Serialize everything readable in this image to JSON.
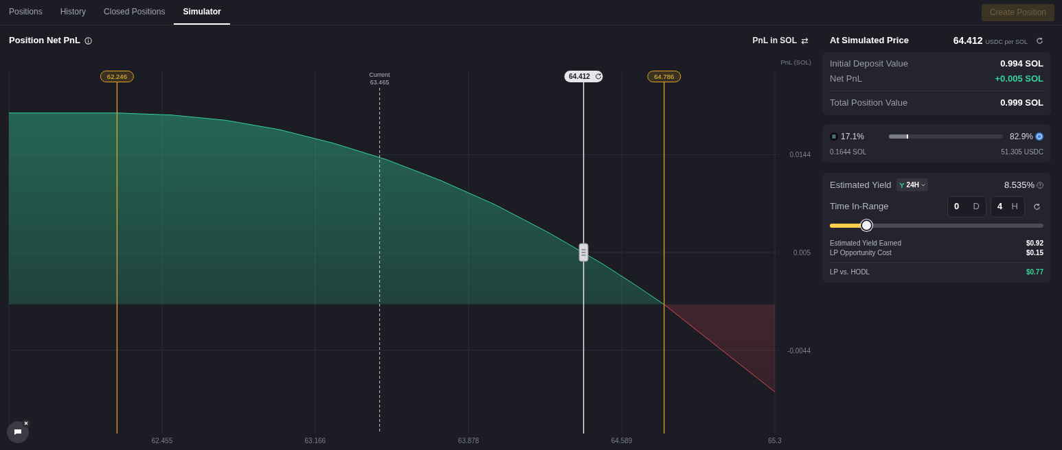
{
  "tabs": [
    {
      "label": "Positions",
      "selected": false
    },
    {
      "label": "History",
      "selected": false
    },
    {
      "label": "Closed Positions",
      "selected": false
    },
    {
      "label": "Simulator",
      "selected": true
    }
  ],
  "create_button": {
    "label": "Create Position",
    "disabled": true
  },
  "chart_panel": {
    "title": "Position Net PnL",
    "unit_toggle": "PnL in SOL",
    "markers": [
      {
        "kind": "range"
      },
      {
        "kind": "current",
        "title": "Current"
      },
      {
        "kind": "simulated"
      },
      {
        "kind": "range"
      }
    ],
    "chart_data": {
      "type": "area",
      "ylabel": "PnL (SOL)",
      "grid": true,
      "x": [
        61.744,
        62.246,
        62.5,
        62.75,
        63.0,
        63.25,
        63.5,
        63.75,
        64.0,
        64.25,
        64.5,
        64.65,
        64.786,
        65.3
      ],
      "series": [
        {
          "color": "#34d399",
          "values": [
            0.0184,
            0.0184,
            0.0182,
            0.0177,
            0.0168,
            0.0155,
            0.0139,
            0.0119,
            0.0096,
            0.0069,
            0.0039,
            0.0019,
            0.0,
            -0.0084
          ]
        }
      ],
      "xlim": [
        61.744,
        65.3
      ],
      "ylim": [
        -0.0124,
        0.0224
      ],
      "xticks": [
        62.455,
        63.166,
        63.878,
        64.589,
        65.3
      ],
      "yticks": [
        0.0144,
        0.005,
        -0.0044
      ],
      "ref_lines": [
        {
          "axis": "x",
          "value": 62.246,
          "label": "62.246",
          "color": "#e0a526"
        },
        {
          "axis": "x",
          "value": 63.465,
          "label": "63.465",
          "color": "#c8c9ce"
        },
        {
          "axis": "x",
          "value": 64.412,
          "label": "64.412",
          "color": "#e5e6ea"
        },
        {
          "axis": "x",
          "value": 64.786,
          "label": "64.786",
          "color": "#e0a526"
        }
      ]
    }
  },
  "summary": {
    "title": "At Simulated Price",
    "price": "64.412",
    "price_unit": "USDC per SOL",
    "rows": [
      {
        "label": "Initial Deposit Value",
        "value": "0.994 SOL",
        "color": "#ffffff"
      },
      {
        "label": "Net PnL",
        "value": "+0.005 SOL",
        "color": "#34d399"
      }
    ],
    "total": {
      "label": "Total Position Value",
      "value": "0.999 SOL"
    }
  },
  "composition": {
    "level": 0.171,
    "left": {
      "percent": "17.1%",
      "amount": "0.1644 SOL"
    },
    "right": {
      "percent": "82.9%",
      "amount": "51.305 USDC"
    }
  },
  "yield": {
    "label": "Estimated Yield",
    "period": "24H",
    "value": "8.535%",
    "time_label": "Time In-Range",
    "days": "0",
    "day_unit": "D",
    "hours": "4",
    "hour_unit": "H",
    "level": 0.17,
    "rows": [
      {
        "label": "Estimated Yield Earned",
        "value": "$0.92"
      },
      {
        "label": "LP Opportunity Cost",
        "value": "$0.15"
      }
    ],
    "result": {
      "label": "LP vs. HODL",
      "value": "$0.77",
      "color": "#34d399"
    }
  }
}
